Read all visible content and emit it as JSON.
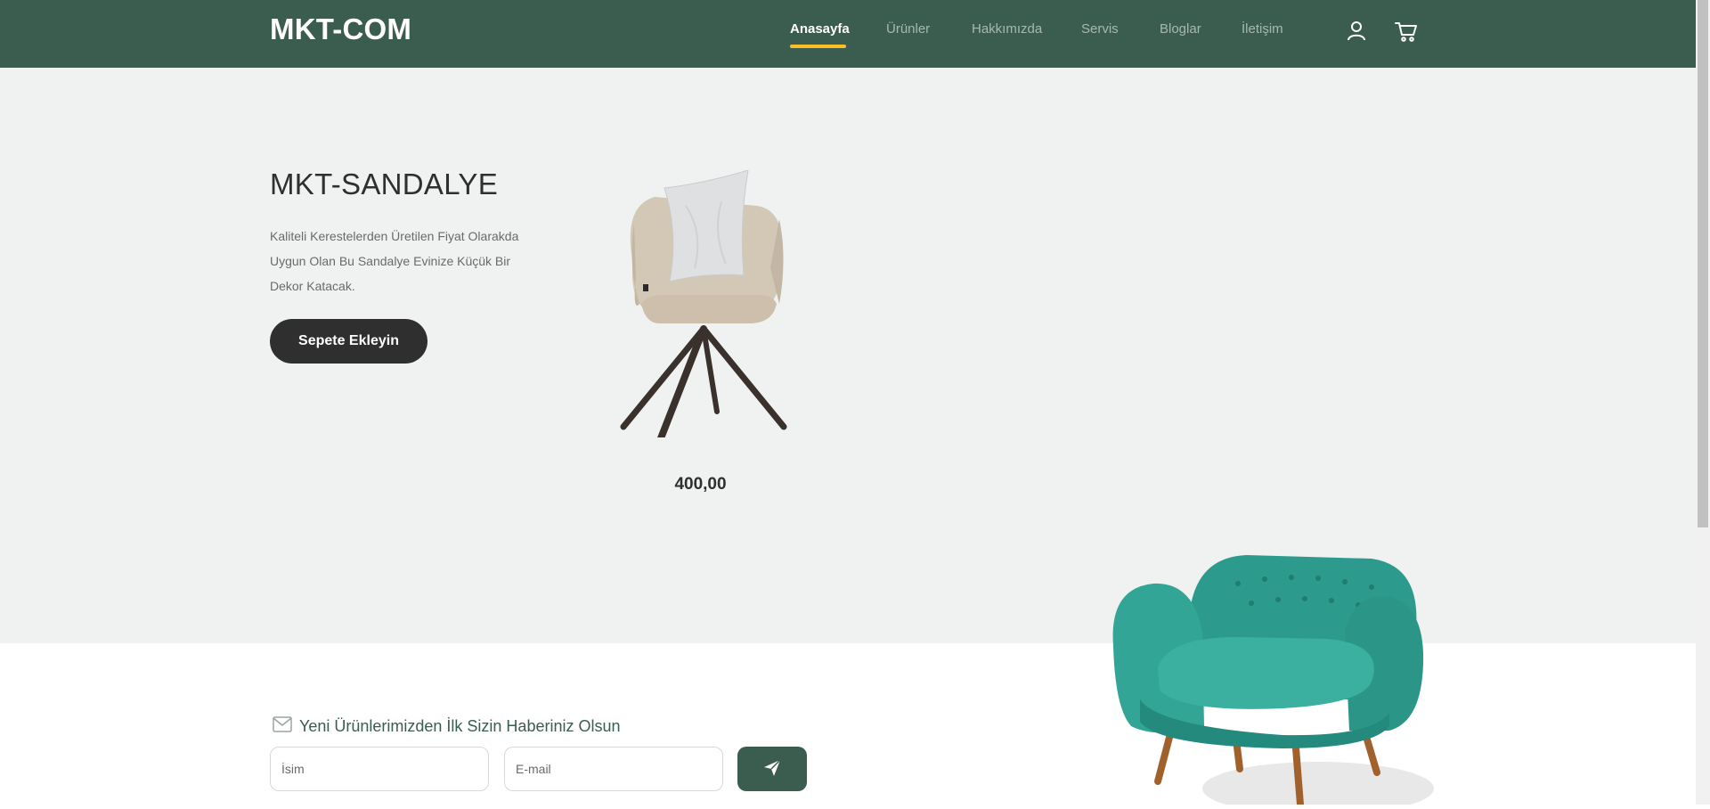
{
  "header": {
    "brand": "MKT-COM",
    "nav": [
      {
        "label": "Anasayfa",
        "active": true
      },
      {
        "label": "Ürünler",
        "active": false
      },
      {
        "label": "Hakkımızda",
        "active": false
      },
      {
        "label": "Servis",
        "active": false
      },
      {
        "label": "Bloglar",
        "active": false
      },
      {
        "label": "İletişim",
        "active": false
      }
    ],
    "icons": [
      "user-icon",
      "cart-icon"
    ]
  },
  "hero": {
    "title": "MKT-SANDALYE",
    "description": "Kaliteli Kerestelerden Üretilen Fiyat Olarakda Uygun Olan Bu Sandalye Evinize Küçük Bir Dekor Katacak.",
    "button_label": "Sepete Ekleyin",
    "price": "400,00"
  },
  "newsletter": {
    "heading": "Yeni Ürünlerimizden İlk Sizin Haberiniz Olsun",
    "name_placeholder": "İsim",
    "email_placeholder": "E-mail",
    "icon": "envelope-icon",
    "send_icon": "paper-plane-icon"
  },
  "colors": {
    "primary": "#3b5d50",
    "accent": "#f9bf29",
    "dark": "#2f2f2f",
    "hero_bg": "#eff2f1"
  }
}
